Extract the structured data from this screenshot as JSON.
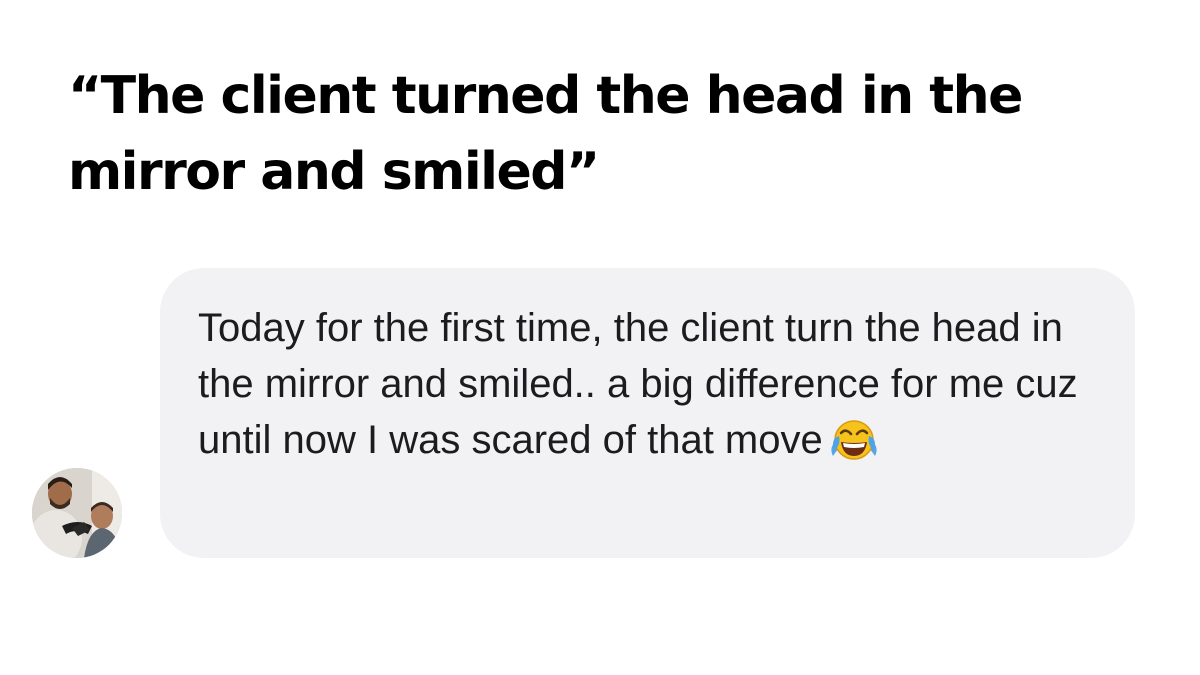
{
  "headline": {
    "text": "“The client turned the head in the mirror and smiled”"
  },
  "message": {
    "text": "Today for the first time, the client turn the head in the mirror and smiled.. a big difference for me cuz until now I was scared of that move",
    "emoji": "face-with-tears-of-joy",
    "bubble_color": "#f2f2f5",
    "text_color": "#1c1c1e"
  },
  "sender": {
    "avatar": "barber-photo"
  }
}
